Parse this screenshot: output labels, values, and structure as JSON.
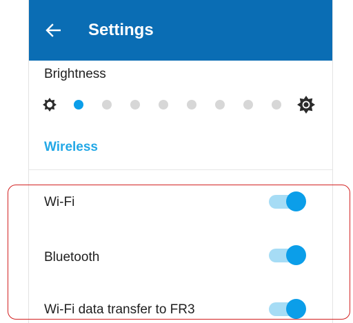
{
  "header": {
    "title": "Settings",
    "color": "#0a6db4",
    "back_icon": "arrow-left-icon"
  },
  "brightness": {
    "label": "Brightness",
    "level": 1,
    "levels": 10,
    "min_icon": "sun-low-icon",
    "max_icon": "sun-high-icon",
    "active_color": "#0b9ee9"
  },
  "wireless": {
    "section_label": "Wireless",
    "accent_color": "#23a8e6",
    "items": [
      {
        "label": "Wi-Fi",
        "on": true
      },
      {
        "label": "Bluetooth",
        "on": true
      },
      {
        "label": "Wi-Fi data transfer to FR3",
        "on": true
      }
    ]
  }
}
